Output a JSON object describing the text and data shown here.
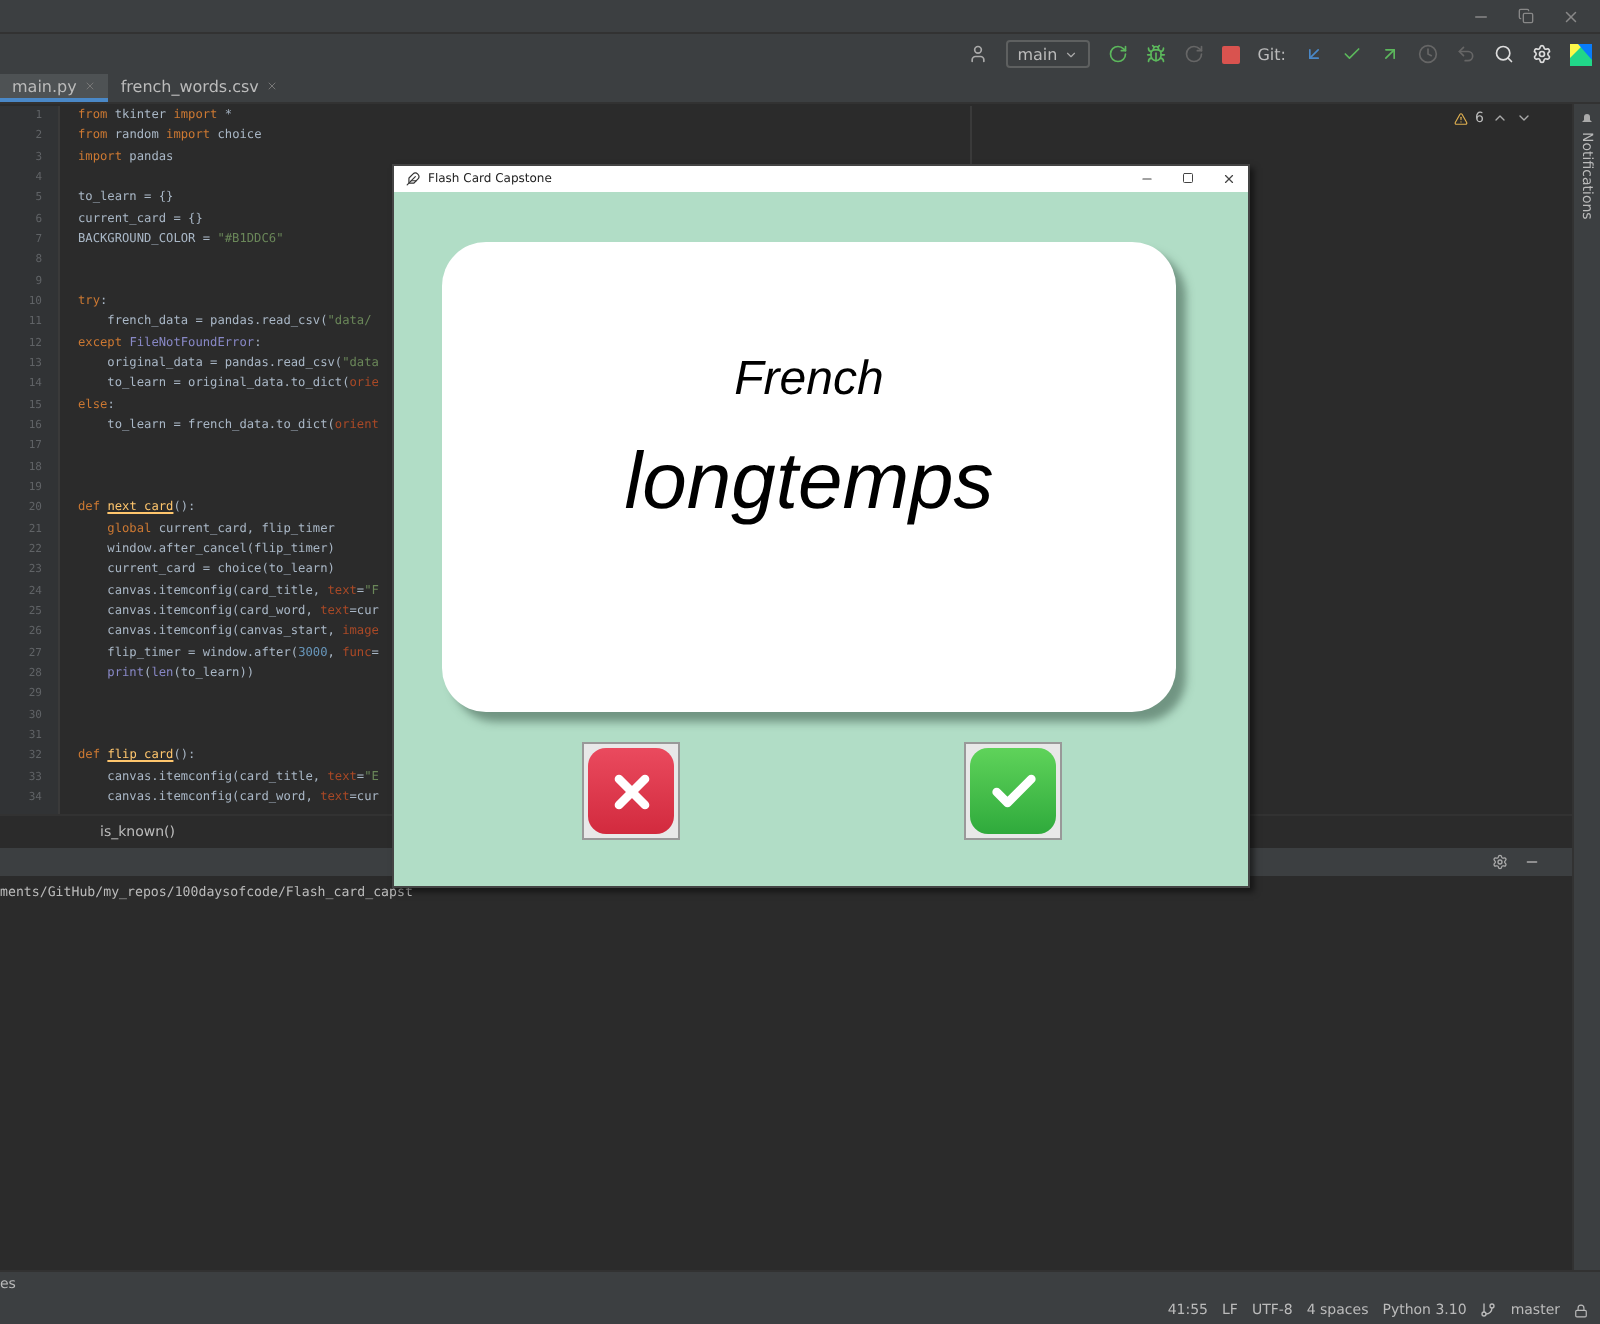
{
  "toolbar": {
    "run_config": "main",
    "git_label": "Git:"
  },
  "tabs": [
    {
      "label": "main.py",
      "selected": true
    },
    {
      "label": "french_words.csv",
      "selected": false
    }
  ],
  "editor": {
    "warnings": "6",
    "lines": [
      {
        "n": "1",
        "indented": false,
        "tokens": [
          {
            "text": "from",
            "kind": "kw"
          },
          {
            "text": " tkinter ",
            "kind": "plain"
          },
          {
            "text": "import",
            "kind": "kw"
          },
          {
            "text": " *",
            "kind": "plain"
          }
        ]
      },
      {
        "n": "2",
        "indented": false,
        "tokens": [
          {
            "text": "from",
            "kind": "kw"
          },
          {
            "text": " random ",
            "kind": "plain"
          },
          {
            "text": "import",
            "kind": "kw"
          },
          {
            "text": " choice",
            "kind": "plain"
          }
        ]
      },
      {
        "n": "3",
        "indented": false,
        "tokens": [
          {
            "text": "import",
            "kind": "kw"
          },
          {
            "text": " pandas",
            "kind": "plain"
          }
        ]
      },
      {
        "n": "4"
      },
      {
        "n": "5",
        "indented": false,
        "tokens": [
          {
            "text": "to_learn = {}",
            "kind": "plain"
          }
        ]
      },
      {
        "n": "6",
        "indented": false,
        "tokens": [
          {
            "text": "current_card = {}",
            "kind": "plain"
          }
        ]
      },
      {
        "n": "7",
        "indented": false,
        "tokens": [
          {
            "text": "BACKGROUND_COLOR = ",
            "kind": "plain"
          },
          {
            "text": "\"#B1DDC6\"",
            "kind": "str"
          }
        ]
      },
      {
        "n": "8"
      },
      {
        "n": "9"
      },
      {
        "n": "10",
        "indented": false,
        "tokens": [
          {
            "text": "try",
            "kind": "kw"
          },
          {
            "text": ":",
            "kind": "plain"
          }
        ]
      },
      {
        "n": "11",
        "indented": true,
        "tokens": [
          {
            "text": "french_data = pandas.read_csv(",
            "kind": "plain"
          },
          {
            "text": "\"data/",
            "kind": "str"
          }
        ]
      },
      {
        "n": "12",
        "indented": false,
        "tokens": [
          {
            "text": "except ",
            "kind": "kw"
          },
          {
            "text": "FileNotFoundError",
            "kind": "builtin"
          },
          {
            "text": ":",
            "kind": "plain"
          }
        ]
      },
      {
        "n": "13",
        "indented": true,
        "tokens": [
          {
            "text": "original_data = pandas.read_csv(",
            "kind": "plain"
          },
          {
            "text": "\"data",
            "kind": "str"
          }
        ]
      },
      {
        "n": "14",
        "indented": true,
        "tokens": [
          {
            "text": "to_learn = original_data.to_dict(",
            "kind": "plain"
          },
          {
            "text": "orie",
            "kind": "kwarg"
          }
        ]
      },
      {
        "n": "15",
        "indented": false,
        "tokens": [
          {
            "text": "else",
            "kind": "kw"
          },
          {
            "text": ":",
            "kind": "plain"
          }
        ]
      },
      {
        "n": "16",
        "indented": true,
        "tokens": [
          {
            "text": "to_learn = french_data.to_dict(",
            "kind": "plain"
          },
          {
            "text": "orient",
            "kind": "kwarg"
          }
        ]
      },
      {
        "n": "17"
      },
      {
        "n": "18"
      },
      {
        "n": "19"
      },
      {
        "n": "20",
        "indented": false,
        "tokens": [
          {
            "text": "def ",
            "kind": "kw"
          },
          {
            "text": "next_card",
            "kind": "fn"
          },
          {
            "text": "():",
            "kind": "plain"
          }
        ]
      },
      {
        "n": "21",
        "indented": true,
        "tokens": [
          {
            "text": "global",
            "kind": "kw"
          },
          {
            "text": " current_card, flip_timer",
            "kind": "plain"
          }
        ]
      },
      {
        "n": "22",
        "indented": true,
        "tokens": [
          {
            "text": "window.after_cancel(flip_timer)",
            "kind": "plain"
          }
        ]
      },
      {
        "n": "23",
        "indented": true,
        "tokens": [
          {
            "text": "current_card = choice(to_learn)",
            "kind": "plain"
          }
        ]
      },
      {
        "n": "24",
        "indented": true,
        "tokens": [
          {
            "text": "canvas.itemconfig(card_title, ",
            "kind": "plain"
          },
          {
            "text": "text",
            "kind": "kwarg"
          },
          {
            "text": "=",
            "kind": "plain"
          },
          {
            "text": "\"F",
            "kind": "str"
          }
        ]
      },
      {
        "n": "25",
        "indented": true,
        "tokens": [
          {
            "text": "canvas.itemconfig(card_word, ",
            "kind": "plain"
          },
          {
            "text": "text",
            "kind": "kwarg"
          },
          {
            "text": "=cur",
            "kind": "plain"
          }
        ]
      },
      {
        "n": "26",
        "indented": true,
        "tokens": [
          {
            "text": "canvas.itemconfig(canvas_start, ",
            "kind": "plain"
          },
          {
            "text": "image",
            "kind": "kwarg"
          }
        ]
      },
      {
        "n": "27",
        "indented": true,
        "tokens": [
          {
            "text": "flip_timer = window.after(",
            "kind": "plain"
          },
          {
            "text": "3000",
            "kind": "num"
          },
          {
            "text": ", ",
            "kind": "plain"
          },
          {
            "text": "func",
            "kind": "kwarg"
          },
          {
            "text": "=",
            "kind": "plain"
          }
        ]
      },
      {
        "n": "28",
        "indented": true,
        "tokens": [
          {
            "text": "print",
            "kind": "builtin"
          },
          {
            "text": "(",
            "kind": "plain"
          },
          {
            "text": "len",
            "kind": "builtin"
          },
          {
            "text": "(to_learn))",
            "kind": "plain"
          }
        ]
      },
      {
        "n": "29"
      },
      {
        "n": "30"
      },
      {
        "n": "31"
      },
      {
        "n": "32",
        "indented": false,
        "tokens": [
          {
            "text": "def ",
            "kind": "kw"
          },
          {
            "text": "flip_card",
            "kind": "fn"
          },
          {
            "text": "():",
            "kind": "plain"
          }
        ]
      },
      {
        "n": "33",
        "indented": true,
        "tokens": [
          {
            "text": "canvas.itemconfig(card_title, ",
            "kind": "plain"
          },
          {
            "text": "text",
            "kind": "kwarg"
          },
          {
            "text": "=",
            "kind": "plain"
          },
          {
            "text": "\"E",
            "kind": "str"
          }
        ]
      },
      {
        "n": "34",
        "indented": true,
        "tokens": [
          {
            "text": "canvas.itemconfig(card_word, ",
            "kind": "plain"
          },
          {
            "text": "text",
            "kind": "kwarg"
          },
          {
            "text": "=cur",
            "kind": "plain"
          }
        ]
      }
    ],
    "breadcrumb": "is_known()"
  },
  "side_panel": {
    "label": "Notifications"
  },
  "terminal": {
    "lines": [
      "ments/GitHub/my_repos/100daysofcode/Flash_card_capst"
    ]
  },
  "tool_strip": {
    "label": "es"
  },
  "status_bar": {
    "items": [
      "41:55",
      "LF",
      "UTF-8",
      "4 spaces",
      "Python 3.10"
    ],
    "branch": "master"
  },
  "app_window": {
    "title": "Flash Card Capstone",
    "card": {
      "title": "French",
      "word": "longtemps"
    },
    "buttons": [
      {
        "kind": "wrong"
      },
      {
        "kind": "right"
      }
    ]
  }
}
